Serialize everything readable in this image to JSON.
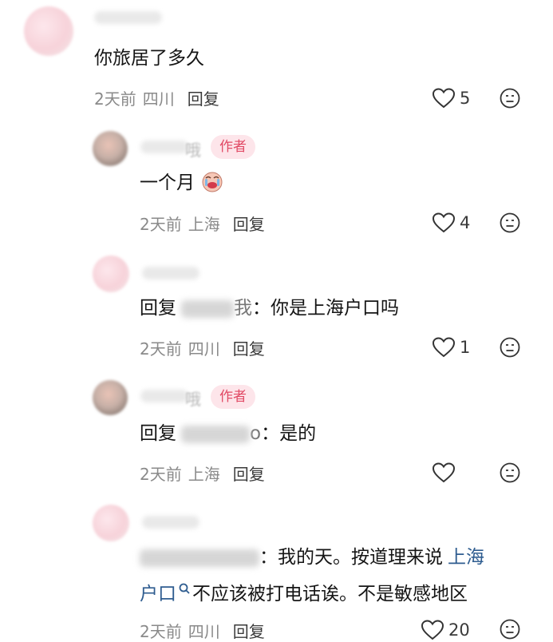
{
  "comments": [
    {
      "text": "你旅居了多久",
      "time": "2天前",
      "location": "四川",
      "reply_label": "回复",
      "likes": "5"
    },
    {
      "author_badge": "作者",
      "name_tail": "哦",
      "text": "一个月",
      "emoji": "crying-face-emoji",
      "time": "2天前",
      "location": "上海",
      "reply_label": "回复",
      "likes": "4"
    },
    {
      "reply_prefix": "回复",
      "reply_target_tail": "我",
      "colon": "：",
      "text": "你是上海户口吗",
      "time": "2天前",
      "location": "四川",
      "reply_label": "回复",
      "likes": "1"
    },
    {
      "author_badge": "作者",
      "name_tail": "哦",
      "reply_prefix": "回复",
      "reply_target_tail": "o",
      "colon": "：",
      "text": "是的",
      "time": "2天前",
      "location": "上海",
      "reply_label": "回复",
      "likes": ""
    },
    {
      "colon": "：",
      "text_before_link": "我的天。按道理来说",
      "link_line1": "上海",
      "link_line2": "户口",
      "text_after_link": "不应该被打电话诶。不是敏感地区",
      "time": "2天前",
      "location": "四川",
      "reply_label": "回复",
      "likes": "20"
    }
  ],
  "colors": {
    "author_badge_bg": "#fde5ea",
    "author_badge_text": "#e14a65",
    "link": "#2f5d90",
    "meta": "#8a8a8a"
  }
}
